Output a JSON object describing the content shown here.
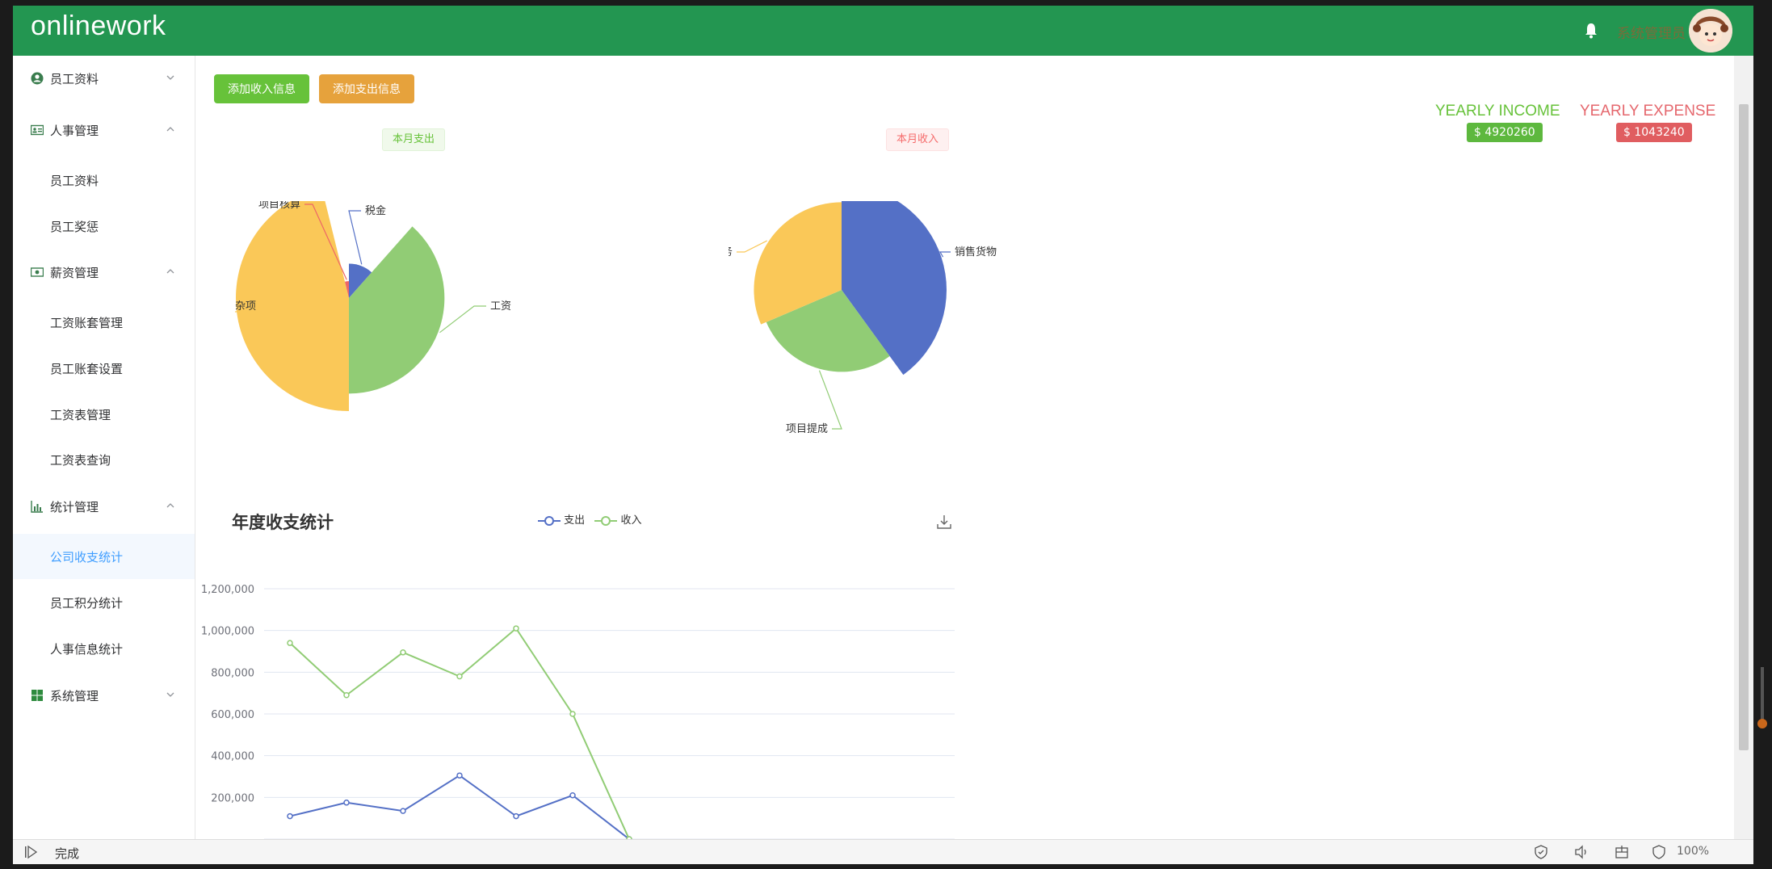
{
  "header": {
    "logo": "onlinework",
    "username": "系统管理员"
  },
  "sidebar": {
    "groups": [
      {
        "label": "员工资料",
        "icon": "user-circle-icon"
      },
      {
        "label": "人事管理",
        "icon": "id-card-icon"
      },
      {
        "label": "薪资管理",
        "icon": "money-icon"
      },
      {
        "label": "统计管理",
        "icon": "bar-chart-icon"
      },
      {
        "label": "系统管理",
        "icon": "windows-icon"
      }
    ],
    "items": {
      "hr_profile": "员工资料",
      "hr_reward": "员工奖惩",
      "salary_set": "工资账套管理",
      "salary_emp_set": "员工账套设置",
      "salary_table": "工资表管理",
      "salary_query": "工资表查询",
      "stat_company": "公司收支统计",
      "stat_points": "员工积分统计",
      "stat_hr": "人事信息统计"
    }
  },
  "main": {
    "add_income": "添加收入信息",
    "add_expense": "添加支出信息",
    "tag_expense": "本月支出",
    "tag_income": "本月收入",
    "yearly_income_title": "YEARLY INCOME",
    "yearly_income_value": "$ 4920260",
    "yearly_expense_title": "YEARLY EXPENSE",
    "yearly_expense_value": "$ 1043240",
    "line_title": "年度收支统计",
    "legend_expense": "支出",
    "legend_income": "收入"
  },
  "colors": {
    "header": "#239651",
    "blue": "#5470c6",
    "green": "#91cc75",
    "yellow": "#fac858",
    "red": "#ee6666"
  },
  "chart_data": [
    {
      "type": "pie",
      "title": "本月支出",
      "rose": "radius",
      "slices": [
        {
          "name": "税金",
          "value": 30,
          "color": "#5470c6"
        },
        {
          "name": "工资",
          "value": 100,
          "color": "#91cc75"
        },
        {
          "name": "杂项",
          "value": 120,
          "color": "#fac858"
        },
        {
          "name": "项目核算",
          "value": 10,
          "color": "#ee6666"
        }
      ]
    },
    {
      "type": "pie",
      "title": "本月收入",
      "rose": "radius",
      "slices": [
        {
          "name": "销售货物",
          "value": 140,
          "color": "#5470c6"
        },
        {
          "name": "项目提成",
          "value": 100,
          "color": "#91cc75"
        },
        {
          "name": "提供劳务",
          "value": 110,
          "color": "#fac858"
        }
      ]
    },
    {
      "type": "line",
      "title": "年度收支统计",
      "ylim": [
        0,
        1200000
      ],
      "yticks": [
        "1,200,000",
        "1,000,000",
        "800,000",
        "600,000",
        "400,000",
        "200,000"
      ],
      "series": [
        {
          "name": "支出",
          "color": "#5470c6",
          "values": [
            110000,
            175000,
            135000,
            305000,
            110000,
            210000,
            0
          ]
        },
        {
          "name": "收入",
          "color": "#91cc75",
          "values": [
            940000,
            690000,
            895000,
            780000,
            1010000,
            600000,
            0
          ]
        }
      ]
    }
  ],
  "statusbar": {
    "status": "完成",
    "zoom": "100%"
  }
}
